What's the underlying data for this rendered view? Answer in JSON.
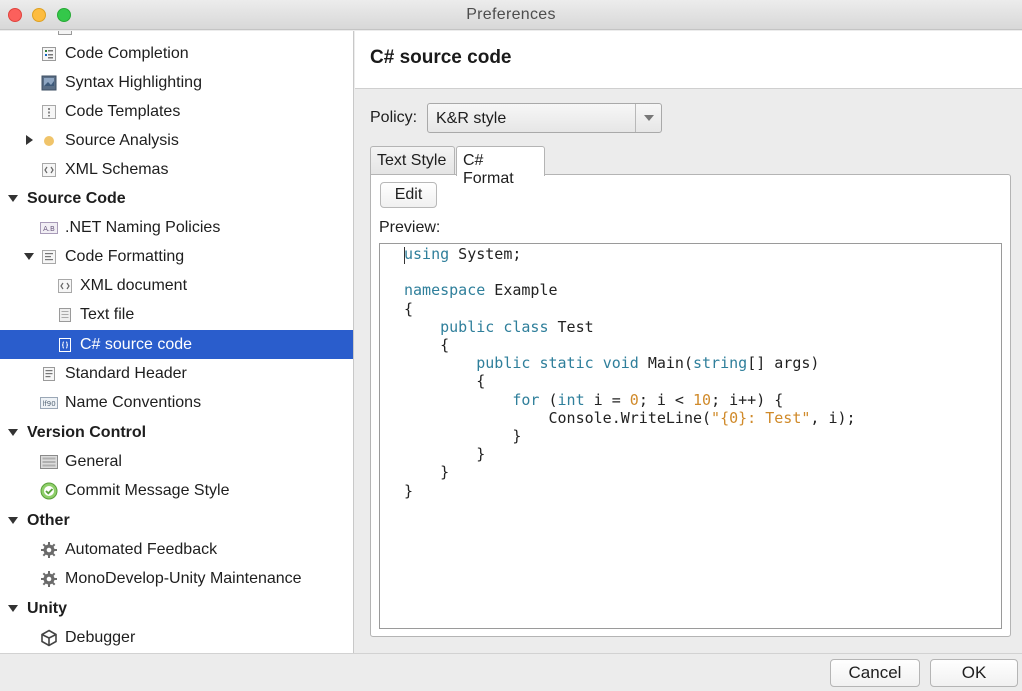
{
  "window": {
    "title": "Preferences"
  },
  "sidebar": {
    "items": [
      {
        "label": "Code Completion",
        "icon": "list-icon"
      },
      {
        "label": "Syntax Highlighting",
        "icon": "image-icon"
      },
      {
        "label": "Code Templates",
        "icon": "template-icon"
      },
      {
        "label": "Source Analysis",
        "icon": "dot-icon"
      },
      {
        "label": "XML Schemas",
        "icon": "xml-icon"
      },
      {
        "label": "Source Code",
        "icon": ""
      },
      {
        "label": ".NET Naming Policies",
        "icon": "naming-icon"
      },
      {
        "label": "Code Formatting",
        "icon": "format-icon"
      },
      {
        "label": "XML document",
        "icon": "xml-icon"
      },
      {
        "label": "Text file",
        "icon": "file-icon"
      },
      {
        "label": "C# source code",
        "icon": "code-file-icon"
      },
      {
        "label": "Standard Header",
        "icon": "header-icon"
      },
      {
        "label": "Name Conventions",
        "icon": "conventions-icon"
      },
      {
        "label": "Version Control",
        "icon": ""
      },
      {
        "label": "General",
        "icon": "general-icon"
      },
      {
        "label": "Commit Message Style",
        "icon": "check-icon"
      },
      {
        "label": "Other",
        "icon": ""
      },
      {
        "label": "Automated Feedback",
        "icon": "gear-icon"
      },
      {
        "label": "MonoDevelop-Unity Maintenance",
        "icon": "gear-icon"
      },
      {
        "label": "Unity",
        "icon": ""
      },
      {
        "label": "Debugger",
        "icon": "unity-icon"
      }
    ]
  },
  "main": {
    "title": "C# source code",
    "policy_label": "Policy:",
    "policy_value": "K&R style",
    "tabs": [
      {
        "label": "Text Style"
      },
      {
        "label": "C# Format"
      }
    ],
    "edit_label": "Edit",
    "preview_label": "Preview:",
    "code_lines": [
      "using System;",
      "",
      "namespace Example",
      "{",
      "    public class Test",
      "    {",
      "        public static void Main(string[] args)",
      "        {",
      "            for (int i = 0; i < 10; i++) {",
      "                Console.WriteLine(\"{0}: Test\", i);",
      "            }",
      "        }",
      "    }",
      "}"
    ]
  },
  "footer": {
    "cancel_label": "Cancel",
    "ok_label": "OK"
  },
  "colors": {
    "selection": "#2a5dcc",
    "keyword": "#2f7f9b",
    "literal": "#d08a2a"
  }
}
